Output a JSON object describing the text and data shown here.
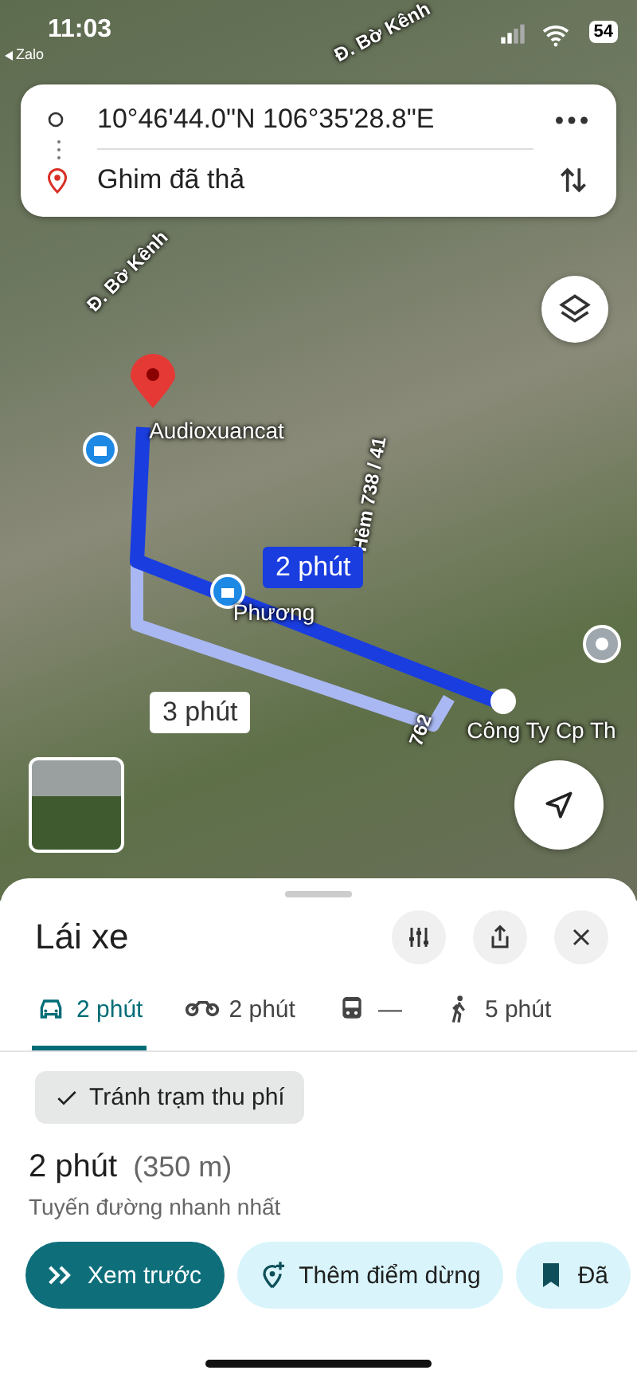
{
  "status_bar": {
    "time": "11:03",
    "back_app": "Zalo",
    "battery": "54"
  },
  "route_card": {
    "origin": "10°46'44.0\"N 106°35'28.8\"E",
    "destination": "Ghim đã thả"
  },
  "map_labels": [
    {
      "kind": "road",
      "text": "Đ. Bờ Kênh"
    },
    {
      "kind": "road",
      "text": "Đ. Bờ Kênh"
    },
    {
      "kind": "place",
      "text": "Audioxuancat"
    },
    {
      "kind": "road",
      "text": "Hẻm 738 / 41"
    },
    {
      "kind": "place",
      "text": "Phương"
    },
    {
      "kind": "road",
      "text": "762"
    },
    {
      "kind": "place",
      "text": "Công Ty Cp Th"
    }
  ],
  "route_badges": [
    {
      "text": "2 phút",
      "selected": true
    },
    {
      "text": "3 phút",
      "selected": false
    }
  ],
  "sheet": {
    "title": "Lái xe",
    "modes": [
      {
        "kind": "car",
        "label": "2 phút",
        "selected": true
      },
      {
        "kind": "motorbike",
        "label": "2 phút",
        "selected": false
      },
      {
        "kind": "transit",
        "label": "—",
        "selected": false
      },
      {
        "kind": "walk",
        "label": "5 phút",
        "selected": false
      }
    ],
    "option_chip": {
      "label": "Tránh trạm thu phí",
      "checked": true
    },
    "duration": "2 phút",
    "distance": "(350 m)",
    "summary": "Tuyến đường nhanh nhất",
    "actions": [
      {
        "kind": "preview",
        "label": "Xem trước",
        "primary": true
      },
      {
        "kind": "add-stop",
        "label": "Thêm điểm dừng",
        "primary": false
      },
      {
        "kind": "save",
        "label": "Đã",
        "primary": false
      }
    ]
  }
}
